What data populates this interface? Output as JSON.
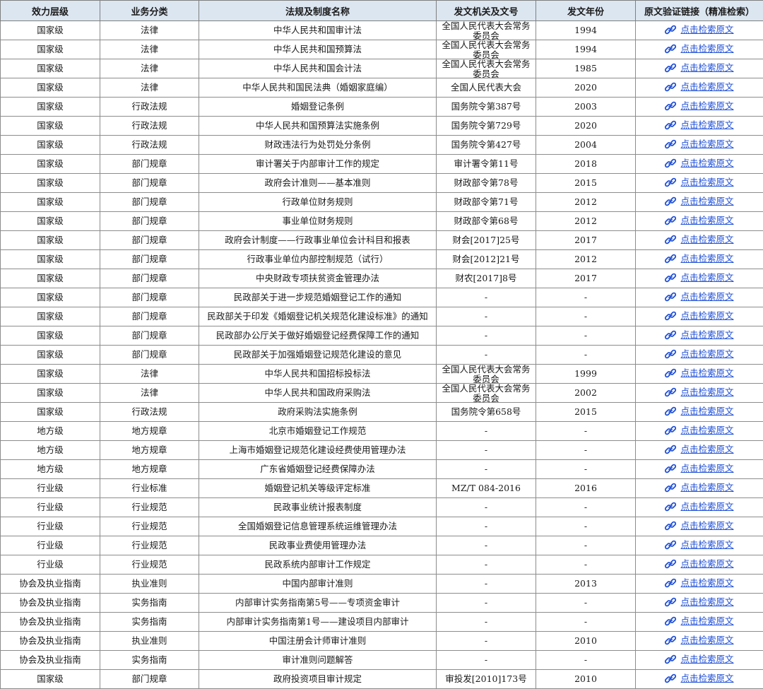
{
  "headers": [
    "效力层级",
    "业务分类",
    "法规及制度名称",
    "发文机关及文号",
    "发文年份",
    "原文验证链接（精准检索）"
  ],
  "link_label": "点击检索原文",
  "link_icon": "link-icon",
  "link_color": "#1f4fd6",
  "header_bg": "#dce6f1",
  "rows": [
    {
      "level": "国家级",
      "category": "法律",
      "name": "中华人民共和国审计法",
      "issuer": "全国人民代表大会常务委员会",
      "year": "1994"
    },
    {
      "level": "国家级",
      "category": "法律",
      "name": "中华人民共和国预算法",
      "issuer": "全国人民代表大会常务委员会",
      "year": "1994"
    },
    {
      "level": "国家级",
      "category": "法律",
      "name": "中华人民共和国会计法",
      "issuer": "全国人民代表大会常务委员会",
      "year": "1985"
    },
    {
      "level": "国家级",
      "category": "法律",
      "name": "中华人民共和国民法典（婚姻家庭编）",
      "issuer": "全国人民代表大会",
      "year": "2020"
    },
    {
      "level": "国家级",
      "category": "行政法规",
      "name": "婚姻登记条例",
      "issuer": "国务院令第387号",
      "year": "2003"
    },
    {
      "level": "国家级",
      "category": "行政法规",
      "name": "中华人民共和国预算法实施条例",
      "issuer": "国务院令第729号",
      "year": "2020"
    },
    {
      "level": "国家级",
      "category": "行政法规",
      "name": "财政违法行为处罚处分条例",
      "issuer": "国务院令第427号",
      "year": "2004"
    },
    {
      "level": "国家级",
      "category": "部门规章",
      "name": "审计署关于内部审计工作的规定",
      "issuer": "审计署令第11号",
      "year": "2018"
    },
    {
      "level": "国家级",
      "category": "部门规章",
      "name": "政府会计准则——基本准则",
      "issuer": "财政部令第78号",
      "year": "2015"
    },
    {
      "level": "国家级",
      "category": "部门规章",
      "name": "行政单位财务规则",
      "issuer": "财政部令第71号",
      "year": "2012"
    },
    {
      "level": "国家级",
      "category": "部门规章",
      "name": "事业单位财务规则",
      "issuer": "财政部令第68号",
      "year": "2012"
    },
    {
      "level": "国家级",
      "category": "部门规章",
      "name": "政府会计制度——行政事业单位会计科目和报表",
      "issuer": "财会[2017]25号",
      "year": "2017"
    },
    {
      "level": "国家级",
      "category": "部门规章",
      "name": "行政事业单位内部控制规范（试行）",
      "issuer": "财会[2012]21号",
      "year": "2012"
    },
    {
      "level": "国家级",
      "category": "部门规章",
      "name": "中央财政专项扶贫资金管理办法",
      "issuer": "财农[2017]8号",
      "year": "2017"
    },
    {
      "level": "国家级",
      "category": "部门规章",
      "name": "民政部关于进一步规范婚姻登记工作的通知",
      "issuer": "-",
      "year": "-"
    },
    {
      "level": "国家级",
      "category": "部门规章",
      "name": "民政部关于印发《婚姻登记机关规范化建设标准》的通知",
      "issuer": "-",
      "year": "-"
    },
    {
      "level": "国家级",
      "category": "部门规章",
      "name": "民政部办公厅关于做好婚姻登记经费保障工作的通知",
      "issuer": "-",
      "year": "-"
    },
    {
      "level": "国家级",
      "category": "部门规章",
      "name": "民政部关于加强婚姻登记规范化建设的意见",
      "issuer": "-",
      "year": "-"
    },
    {
      "level": "国家级",
      "category": "法律",
      "name": "中华人民共和国招标投标法",
      "issuer": "全国人民代表大会常务委员会",
      "year": "1999"
    },
    {
      "level": "国家级",
      "category": "法律",
      "name": "中华人民共和国政府采购法",
      "issuer": "全国人民代表大会常务委员会",
      "year": "2002"
    },
    {
      "level": "国家级",
      "category": "行政法规",
      "name": "政府采购法实施条例",
      "issuer": "国务院令第658号",
      "year": "2015"
    },
    {
      "level": "地方级",
      "category": "地方规章",
      "name": "北京市婚姻登记工作规范",
      "issuer": "-",
      "year": "-"
    },
    {
      "level": "地方级",
      "category": "地方规章",
      "name": "上海市婚姻登记规范化建设经费使用管理办法",
      "issuer": "-",
      "year": "-"
    },
    {
      "level": "地方级",
      "category": "地方规章",
      "name": "广东省婚姻登记经费保障办法",
      "issuer": "-",
      "year": "-"
    },
    {
      "level": "行业级",
      "category": "行业标准",
      "name": "婚姻登记机关等级评定标准",
      "issuer": "MZ/T 084-2016",
      "year": "2016"
    },
    {
      "level": "行业级",
      "category": "行业规范",
      "name": "民政事业统计报表制度",
      "issuer": "-",
      "year": "-"
    },
    {
      "level": "行业级",
      "category": "行业规范",
      "name": "全国婚姻登记信息管理系统运维管理办法",
      "issuer": "-",
      "year": "-"
    },
    {
      "level": "行业级",
      "category": "行业规范",
      "name": "民政事业费使用管理办法",
      "issuer": "-",
      "year": "-"
    },
    {
      "level": "行业级",
      "category": "行业规范",
      "name": "民政系统内部审计工作规定",
      "issuer": "-",
      "year": "-"
    },
    {
      "level": "协会及执业指南",
      "category": "执业准则",
      "name": "中国内部审计准则",
      "issuer": "-",
      "year": "2013"
    },
    {
      "level": "协会及执业指南",
      "category": "实务指南",
      "name": "内部审计实务指南第5号——专项资金审计",
      "issuer": "-",
      "year": "-"
    },
    {
      "level": "协会及执业指南",
      "category": "实务指南",
      "name": "内部审计实务指南第1号——建设项目内部审计",
      "issuer": "-",
      "year": "-"
    },
    {
      "level": "协会及执业指南",
      "category": "执业准则",
      "name": "中国注册会计师审计准则",
      "issuer": "-",
      "year": "2010"
    },
    {
      "level": "协会及执业指南",
      "category": "实务指南",
      "name": "审计准则问题解答",
      "issuer": "-",
      "year": "-"
    },
    {
      "level": "国家级",
      "category": "部门规章",
      "name": "政府投资项目审计规定",
      "issuer": "审投发[2010]173号",
      "year": "2010"
    }
  ]
}
